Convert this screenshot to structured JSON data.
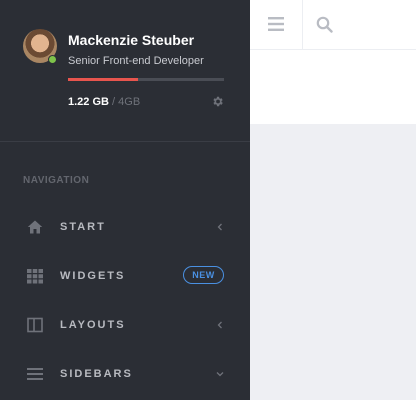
{
  "user": {
    "name": "Mackenzie Steuber",
    "role": "Senior Front-end Developer",
    "status": "online",
    "status_color": "#7ec34b"
  },
  "storage": {
    "used": "1.22 GB",
    "separator": "/",
    "total": "4GB",
    "used_fraction": 0.45,
    "bar_color": "#e8554e"
  },
  "sidebar": {
    "heading": "NAVIGATION",
    "items": [
      {
        "label": "START",
        "icon": "home-icon",
        "arrow": "chevron-left-icon"
      },
      {
        "label": "WIDGETS",
        "icon": "grid-icon",
        "badge": "NEW"
      },
      {
        "label": "LAYOUTS",
        "icon": "layout-columns-icon",
        "arrow": "chevron-left-icon"
      },
      {
        "label": "SIDEBARS",
        "icon": "list-icon",
        "arrow": "chevron-down-icon"
      }
    ]
  },
  "header": {
    "menu_icon": "hamburger-icon",
    "search_icon": "search-icon"
  },
  "colors": {
    "sidebar_bg": "#2b2e35",
    "content_bg": "#eeeff3",
    "accent": "#4a90e2"
  }
}
